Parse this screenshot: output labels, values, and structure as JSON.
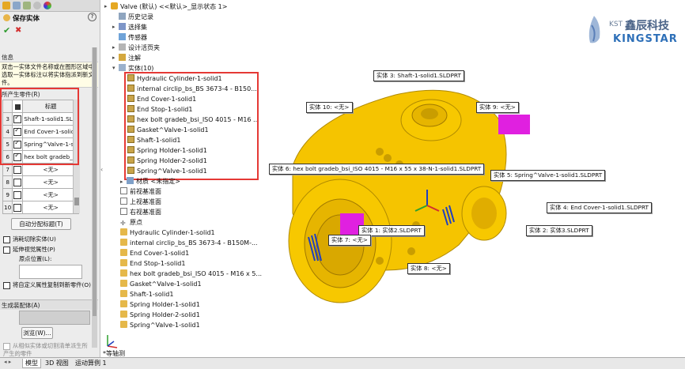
{
  "property_manager": {
    "title": "保存实体",
    "help": "?",
    "ok": "✔",
    "cancel": "✖",
    "info_header": "信息",
    "info_text": "双击一实体文件名称或在图形区域中选取一实体标注以将实体指派到新文件。",
    "parts_header": "所产生零件(R)",
    "col_title": "标题",
    "rows": [
      {
        "num": "3",
        "checked": true,
        "name": "Shaft-1-solid1.SL"
      },
      {
        "num": "4",
        "checked": true,
        "name": "End Cover-1-solid"
      },
      {
        "num": "5",
        "checked": true,
        "name": "Spring^Valve-1-s"
      },
      {
        "num": "6",
        "checked": true,
        "name": "hex bolt gradeb_b"
      },
      {
        "num": "7",
        "checked": false,
        "name": "<无>"
      },
      {
        "num": "8",
        "checked": false,
        "name": "<无>"
      },
      {
        "num": "9",
        "checked": false,
        "name": "<无>"
      },
      {
        "num": "10",
        "checked": false,
        "name": "<无>"
      }
    ],
    "auto_assign": "自动分配标题(T)",
    "opt_consume": "消耗切除实体(U)",
    "opt_extend": "延伸视觉属性(P)",
    "origin_label": "原点位置(L):",
    "opt_copy_props": "将自定义属性复制到新零件(O)",
    "assembly_header": "生成装配体(A)",
    "browse": "浏览(W)...",
    "opt_derive": "从相似实体或切割清单派生所产生的零件"
  },
  "tree": {
    "root": "Valve (默认) <<默认>_显示状态 1>",
    "folders": [
      "历史记录",
      "选择集",
      "传感器",
      "设计活页夹",
      "注解"
    ],
    "solids_folder": "实体(10)",
    "solids": [
      "Hydraulic Cylinder-1-solid1",
      "internal circlip_bs_BS 3673-4 - B150...",
      "End Cover-1-solid1",
      "End Stop-1-solid1",
      "hex bolt gradeb_bsi_ISO 4015 - M16 ...",
      "Gasket^Valve-1-solid1",
      "Shaft-1-solid1",
      "Spring Holder-1-solid1",
      "Spring Holder-2-solid1",
      "Spring^Valve-1-solid1"
    ],
    "material": "材质 <未指定>",
    "planes": [
      "前视基准面",
      "上视基准面",
      "右视基准面"
    ],
    "origin": "原点",
    "features": [
      "Hydraulic Cylinder-1-solid1",
      "internal circlip_bs_BS 3673-4 - B150M-...",
      "End Cover-1-solid1",
      "End Stop-1-solid1",
      "hex bolt gradeb_bsi_ISO 4015 - M16 x 5...",
      "Gasket^Valve-1-solid1",
      "Shaft-1-solid1",
      "Spring Holder-1-solid1",
      "Spring Holder-2-solid1",
      "Spring^Valve-1-solid1"
    ]
  },
  "callouts": {
    "c3": "实体  3:  Shaft-1-solid1.SLDPRT",
    "c10": "实体  10:  <无>",
    "c9": "实体  9:  <无>",
    "c6": "实体  6:  hex bolt gradeb_bsi_ISO 4015 - M16 x 55 x 38-N-1-solid1.SLDPRT",
    "c5": "实体  5:  Spring^Valve-1-solid1.SLDPRT",
    "c4": "实体  4:  End Cover-1-solid1.SLDPRT",
    "c2": "实体  2:  实体3.SLDPRT",
    "c1": "实体  1:  实体2.SLDPRT",
    "c7": "实体  7:  <无>",
    "c8": "实体  8:  <无>"
  },
  "view_label": "*等轴测",
  "logo": {
    "prefix": "KST",
    "cn": "鑫辰科技",
    "en": "KINGSTAR"
  },
  "bottom_tabs": [
    "模型",
    "3D 视图",
    "运动算例 1"
  ],
  "colors": {
    "accent_red": "#e53935",
    "part_yellow": "#f5c400",
    "logo_blue": "#2d6fb8"
  }
}
